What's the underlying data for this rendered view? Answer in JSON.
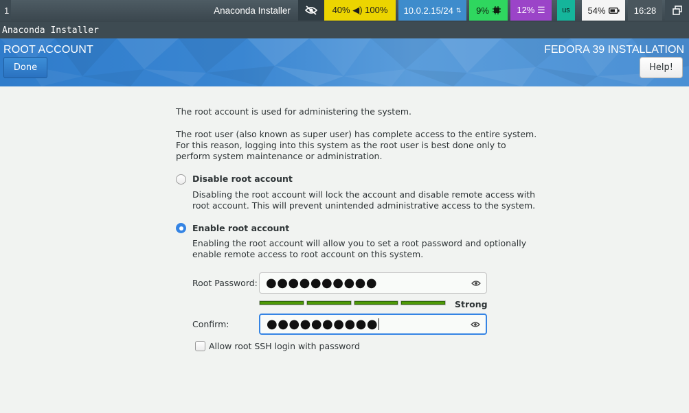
{
  "statusbar": {
    "workspace": "1",
    "window_title": "Anaconda Installer",
    "battery_volume": "40% ◀) 100%",
    "ip": "10.0.2.15/24",
    "cpu": "9%",
    "mem": "12% ☰",
    "keyboard": "us",
    "battery": "54%",
    "clock": "16:28"
  },
  "window": {
    "title": "Anaconda Installer"
  },
  "header": {
    "title": "ROOT ACCOUNT",
    "product": "FEDORA 39 INSTALLATION",
    "done_label": "Done",
    "help_label": "Help!"
  },
  "content": {
    "intro": "The root account is used for administering the system.",
    "desc1": "The root user (also known as super user) has complete access to the entire system.",
    "desc2": "For this reason, logging into this system as the root user is best done only to",
    "desc3": "perform system maintenance or administration.",
    "disable_label": "Disable root account",
    "disable_desc1": "Disabling the root account will lock the account and disable remote access with",
    "disable_desc2": "root account. This will prevent unintended administrative access to the system.",
    "enable_label": "Enable root account",
    "enable_desc1": "Enabling the root account will allow you to set a root password and optionally",
    "enable_desc2": "enable remote access to root account on this system.",
    "password_label": "Root Password:",
    "password_value": "●●●●●●●●●●",
    "strength_label": "Strong",
    "strength_level": 1.0,
    "confirm_label": "Confirm:",
    "confirm_value": "●●●●●●●●●●",
    "ssh_label": "Allow root SSH login with password",
    "selected_option": "enable",
    "ssh_checked": false
  },
  "colors": {
    "accent": "#3584e4",
    "strength_bar": "#4e9a06",
    "header_blue": "#3a86d2"
  }
}
